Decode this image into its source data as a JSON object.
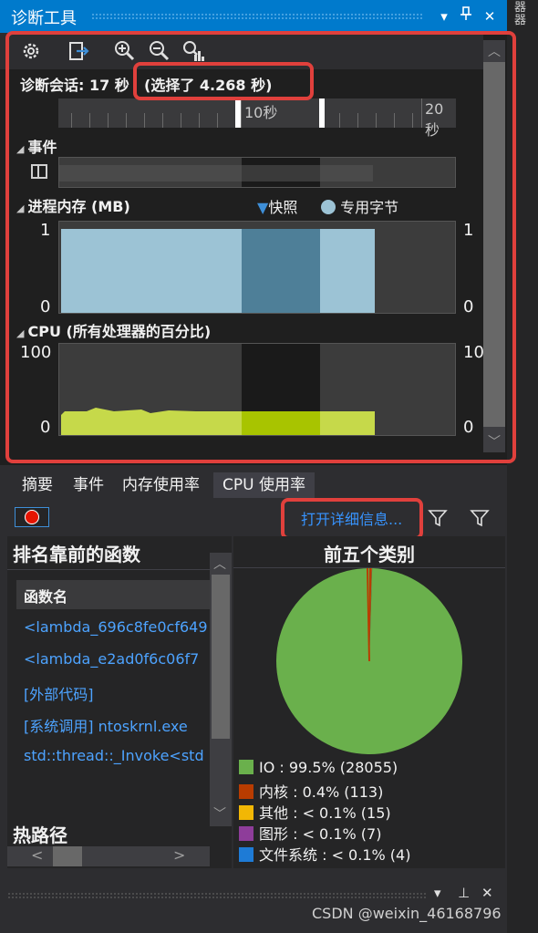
{
  "window": {
    "title": "诊断工具",
    "side_label": "器器"
  },
  "toolbar": {
    "icons": [
      "settings-icon",
      "export-icon",
      "zoom-in-icon",
      "zoom-out-icon",
      "reset-zoom-icon"
    ]
  },
  "session": {
    "label": "诊断会话: 17 秒",
    "selection": "(选择了 4.268 秒)"
  },
  "ruler": {
    "labels": [
      "10秒",
      "20秒"
    ]
  },
  "events": {
    "header": "事件"
  },
  "memory": {
    "header": "进程内存 (MB)",
    "legend_snapshot": "快照",
    "legend_private": "专用字节",
    "y_max_left": "1",
    "y_min_left": "0",
    "y_max_right": "1",
    "y_min_right": "0"
  },
  "cpu_graph": {
    "header": "CPU (所有处理器的百分比)",
    "y_max_left": "100",
    "y_min_left": "0",
    "y_max_right": "10",
    "y_min_right": "0"
  },
  "tabs": [
    "摘要",
    "事件",
    "内存使用率",
    "CPU 使用率"
  ],
  "cpu_panel": {
    "open_details": "打开详细信息...",
    "top_functions_title": "排名靠前的函数",
    "column_header": "函数名",
    "functions": [
      "<lambda_696c8fe0cf649",
      "<lambda_e2ad0f6c06f7",
      "[外部代码]",
      "[系统调用] ntoskrnl.exe",
      "std::thread::_Invoke<std"
    ],
    "hot_path_title": "热路径",
    "top_categories_title": "前五个类别"
  },
  "chart_data": {
    "type": "pie",
    "title": "前五个类别",
    "slices": [
      {
        "label": "IO : 99.5% (28055)",
        "name": "IO",
        "value": 28055,
        "color": "#6ab04c"
      },
      {
        "label": "内核 : 0.4% (113)",
        "name": "内核",
        "value": 113,
        "color": "#b83c00"
      },
      {
        "label": "其他 : < 0.1% (15)",
        "name": "其他",
        "value": 15,
        "color": "#f2b705"
      },
      {
        "label": "图形 : < 0.1% (7)",
        "name": "图形",
        "value": 7,
        "color": "#8e3d9a"
      },
      {
        "label": "文件系统 : < 0.1% (4)",
        "name": "文件系统",
        "value": 4,
        "color": "#1e7bd6"
      }
    ]
  },
  "watermark": "CSDN @weixin_46168796",
  "colors": {
    "accent": "#007acc",
    "link": "#4da3ff",
    "highlight": "#e0403c",
    "memory_fill": "#9cc3d5",
    "cpu_fill": "#c6d94a"
  }
}
